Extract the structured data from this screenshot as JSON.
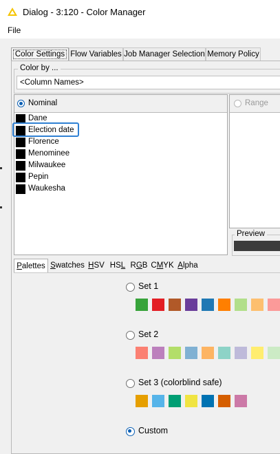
{
  "window": {
    "title": "Dialog - 3:120 - Color Manager"
  },
  "menu": {
    "file": "File"
  },
  "tabs": [
    {
      "label": "Color Settings",
      "active": true
    },
    {
      "label": "Flow Variables",
      "active": false
    },
    {
      "label": "Job Manager Selection",
      "active": false
    },
    {
      "label": "Memory Policy",
      "active": false
    }
  ],
  "color_by": {
    "legend": "Color by ...",
    "value": "<Column Names>"
  },
  "nominal": {
    "label": "Nominal",
    "selected": "Election date",
    "items": [
      "Dane",
      "Election date",
      "Florence",
      "Menominee",
      "Milwaukee",
      "Pepin",
      "Waukesha"
    ]
  },
  "range": {
    "label": "Range"
  },
  "preview": {
    "label": "Preview"
  },
  "chooser_tabs": [
    {
      "label": "Palettes",
      "mnemonic": "P",
      "rest": "alettes",
      "active": true
    },
    {
      "label": "Swatches",
      "mnemonic": "S",
      "rest": "watches",
      "active": false
    },
    {
      "label": "HSV",
      "mnemonic": "H",
      "rest": "SV",
      "active": false
    },
    {
      "label": "HSL",
      "mnemonic": "L",
      "pre": "HS",
      "active": false
    },
    {
      "label": "RGB",
      "mnemonic": "G",
      "pre": "R",
      "rest": "B",
      "active": false
    },
    {
      "label": "CMYK",
      "mnemonic": "M",
      "pre": "C",
      "rest": "YK",
      "active": false
    },
    {
      "label": "Alpha",
      "mnemonic": "A",
      "rest": "lpha",
      "active": false
    }
  ],
  "palettes": [
    {
      "label": "Set 1",
      "selected": false,
      "colors": [
        "#37a33a",
        "#e31e24",
        "#b15928",
        "#6a3d9a",
        "#1f78b4",
        "#ff7f00",
        "#b2df8a",
        "#fdbf6f",
        "#fb9a99"
      ]
    },
    {
      "label": "Set 2",
      "selected": false,
      "colors": [
        "#fb8072",
        "#bc80bd",
        "#b3de69",
        "#80b1d3",
        "#fdb462",
        "#8dd3c7",
        "#bebada",
        "#ffed6f",
        "#ccebc5"
      ]
    },
    {
      "label": "Set 3 (colorblind safe)",
      "selected": false,
      "colors": [
        "#e69f00",
        "#56b4e9",
        "#009e73",
        "#f0e442",
        "#0072b2",
        "#d55e00",
        "#cc79a7"
      ]
    },
    {
      "label": "Custom",
      "selected": true,
      "colors": []
    }
  ],
  "colors": {
    "accent": "#0a5fb4",
    "selection": "#2f80d3",
    "title_icon": "#f5c400"
  }
}
